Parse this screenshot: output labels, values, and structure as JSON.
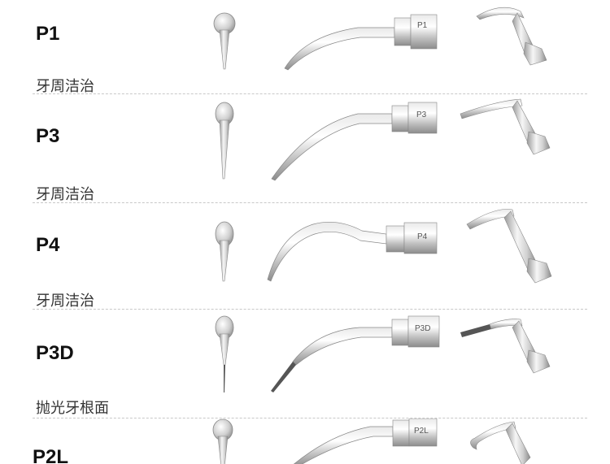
{
  "items": [
    {
      "code": "P1",
      "description": "牙周洁治"
    },
    {
      "code": "P3",
      "description": "牙周洁治"
    },
    {
      "code": "P4",
      "description": "牙周洁治"
    },
    {
      "code": "P3D",
      "description": "抛光牙根面"
    },
    {
      "code": "P2L",
      "description": ""
    }
  ],
  "colors": {
    "metal_light": "#f4f4f4",
    "metal_mid": "#c9c9c9",
    "metal_dark": "#8a8a8a",
    "coating": "#555555"
  }
}
